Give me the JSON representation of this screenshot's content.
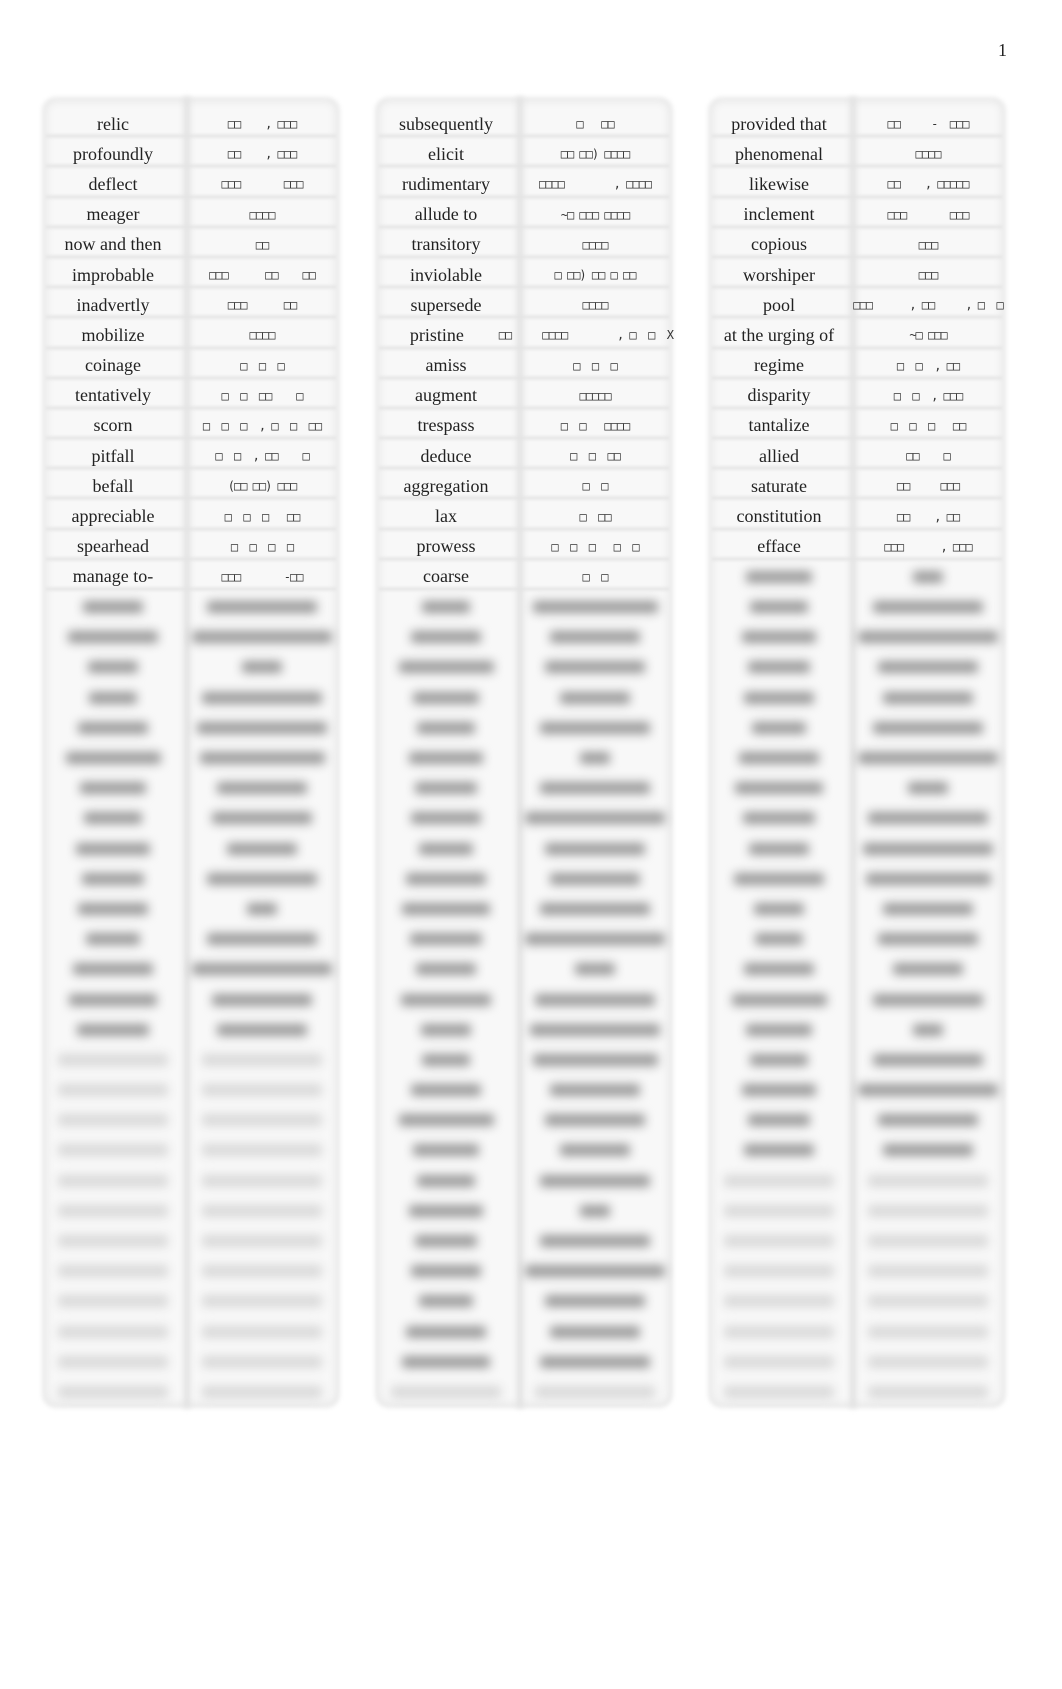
{
  "page": {
    "number": "1"
  },
  "columns": [
    {
      "rows": [
        {
          "en": "relic",
          "ko": "□□    , □□□"
        },
        {
          "en": "profoundly",
          "ko": "□□    , □□□"
        },
        {
          "en": "deflect",
          "ko": "□□□       □□□"
        },
        {
          "en": "meager",
          "ko": "□□□□"
        },
        {
          "en": "now and then",
          "ko": "□□"
        },
        {
          "en": "improbable",
          "ko": "□□□      □□    □□"
        },
        {
          "en": "inadvertly",
          "ko": "□□□      □□"
        },
        {
          "en": "mobilize",
          "ko": "□□□□"
        },
        {
          "en": "coinage",
          "ko": "□  □  □"
        },
        {
          "en": "tentatively",
          "ko": "□  □  □□    □"
        },
        {
          "en": "scorn",
          "ko": "□  □  □  , □  □  □□"
        },
        {
          "en": "pitfall",
          "ko": "□  □  , □□    □"
        },
        {
          "en": "befall",
          "ko": "(□□ □□) □□□"
        },
        {
          "en": "appreciable",
          "ko": "□  □  □   □□"
        },
        {
          "en": "spearhead",
          "ko": "□  □  □  □"
        },
        {
          "en": "manage to-",
          "ko": "□□□       -□□"
        }
      ],
      "blurred_row_count": 15,
      "empty_row_count": 12
    },
    {
      "rows": [
        {
          "en": "subsequently",
          "ko": "□   □□"
        },
        {
          "en": "elicit",
          "ko": "□□ □□) □□□□"
        },
        {
          "en": "rudimentary",
          "ko": "□□□□        , □□□□"
        },
        {
          "en": "allude to",
          "ko": "~□ □□□ □□□□"
        },
        {
          "en": "transitory",
          "ko": "□□□□"
        },
        {
          "en": "inviolable",
          "ko": "□ □□) □□ □ □□"
        },
        {
          "en": "supersede",
          "ko": "□□□□"
        },
        {
          "en": "pristine",
          "ko": "□□     □□□□        , □  □  X"
        },
        {
          "en": "amiss",
          "ko": "□  □  □"
        },
        {
          "en": "augment",
          "ko": "□□□□□"
        },
        {
          "en": "trespass",
          "ko": "□  □   □□□□"
        },
        {
          "en": "deduce",
          "ko": "□  □  □□"
        },
        {
          "en": "aggregation",
          "ko": "□  □"
        },
        {
          "en": "lax",
          "ko": "□  □□"
        },
        {
          "en": "prowess",
          "ko": "□  □  □   □  □"
        },
        {
          "en": "coarse",
          "ko": "□  □"
        }
      ],
      "blurred_row_count": 26,
      "empty_row_count": 1
    },
    {
      "rows": [
        {
          "en": "provided that",
          "ko": "□□     -  □□□"
        },
        {
          "en": "phenomenal",
          "ko": "□□□□"
        },
        {
          "en": "likewise",
          "ko": "□□    , □□□□□"
        },
        {
          "en": "inclement",
          "ko": "□□□       □□□"
        },
        {
          "en": "copious",
          "ko": "□□□"
        },
        {
          "en": "worshiper",
          "ko": "□□□"
        },
        {
          "en": "pool",
          "ko": "□□□      , □□     , □  □"
        },
        {
          "en": "at the urging of",
          "ko": "~□ □□□"
        },
        {
          "en": "regime",
          "ko": "□  □  , □□"
        },
        {
          "en": "disparity",
          "ko": "□  □  , □□□"
        },
        {
          "en": "tantalize",
          "ko": "□  □  □   □□"
        },
        {
          "en": "allied",
          "ko": "□□    □"
        },
        {
          "en": "saturate",
          "ko": "□□     □□□"
        },
        {
          "en": "constitution",
          "ko": "□□    , □□"
        },
        {
          "en": "efface",
          "ko": "□□□      , □□□"
        }
      ],
      "blurred_row_count": 20,
      "empty_row_count": 8
    }
  ]
}
